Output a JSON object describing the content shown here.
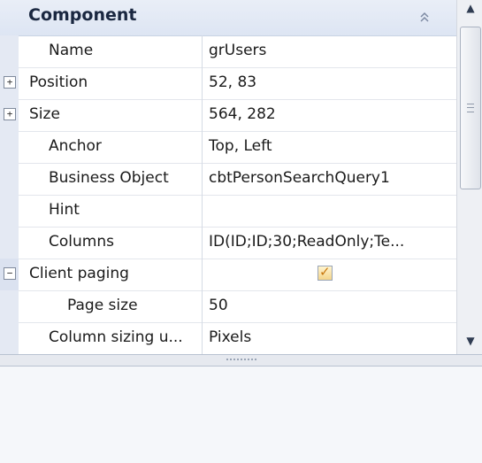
{
  "category": {
    "title": "Component",
    "collapse_glyph": "«"
  },
  "properties": [
    {
      "name": "Name",
      "value": "grUsers"
    },
    {
      "name": "Position",
      "value": "52, 83",
      "expander": "+"
    },
    {
      "name": "Size",
      "value": "564, 282",
      "expander": "+"
    },
    {
      "name": "Anchor",
      "value": "Top, Left"
    },
    {
      "name": "Business Object",
      "value": "cbtPersonSearchQuery1"
    },
    {
      "name": "Hint",
      "value": ""
    },
    {
      "name": "Columns",
      "value": "ID(ID;ID;30;ReadOnly;Te..."
    },
    {
      "name": "Client paging",
      "value": "",
      "expander": "−",
      "checked": true
    },
    {
      "name": "Page size",
      "value": "50"
    },
    {
      "name": "Column sizing u...",
      "value": "Pixels"
    }
  ],
  "icons": {
    "scroll_up": "▲",
    "scroll_down": "▼",
    "checkmark": "✓"
  },
  "colors": {
    "category_bg": "#dde5f3",
    "gutter": "#e4e9f3",
    "checkbox_fill": "#f4d48a"
  }
}
